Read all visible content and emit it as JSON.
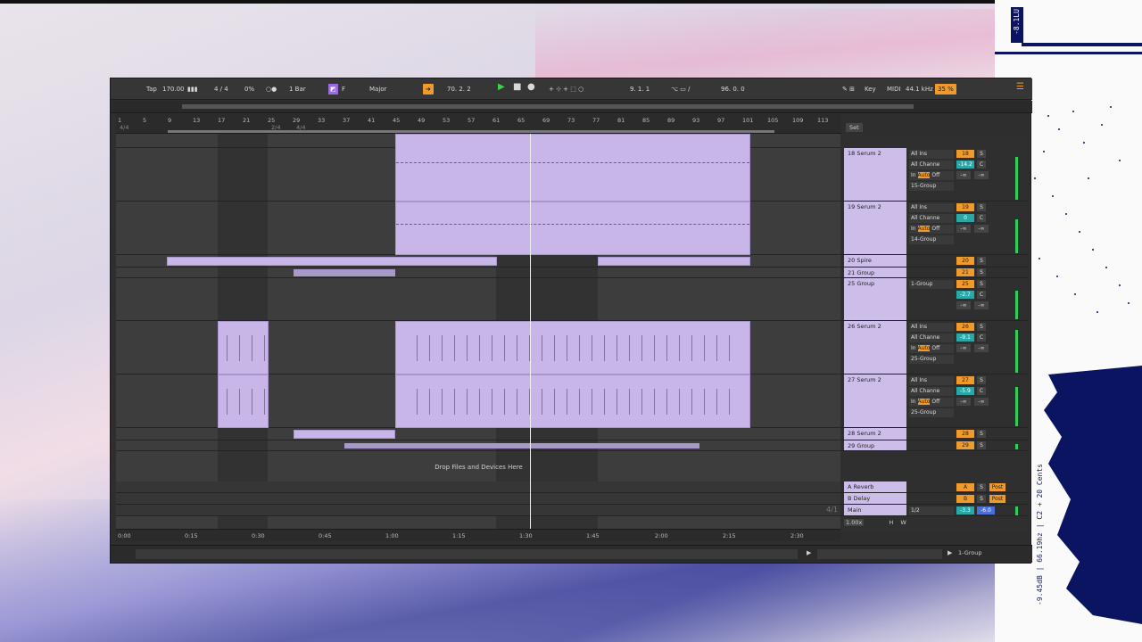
{
  "toolbar": {
    "tap": "Tap",
    "tempo": "170.00",
    "signature": "4 / 4",
    "swing": "0%",
    "quantize": "1 Bar",
    "key_root": "F",
    "scale": "Major",
    "position": "70.   2.   2",
    "loop_start": "9.   1.   1",
    "loop_length": "96.   0.   0",
    "key_label": "Key",
    "midi_label": "MIDI",
    "sample_rate": "44.1 kHz",
    "cpu": "35 %"
  },
  "ruler": {
    "bars": [
      "1",
      "5",
      "9",
      "13",
      "17",
      "21",
      "25",
      "29",
      "33",
      "37",
      "41",
      "45",
      "49",
      "53",
      "57",
      "61",
      "65",
      "69",
      "73",
      "77",
      "81",
      "85",
      "89",
      "93",
      "97",
      "101",
      "105",
      "109",
      "113"
    ],
    "sig_a": "4/4",
    "sig_b": "2/4",
    "sig_c": "4/4"
  },
  "timeline": {
    "times": [
      "0:00",
      "0:15",
      "0:30",
      "0:45",
      "1:00",
      "1:15",
      "1:30",
      "1:45",
      "2:00",
      "2:15",
      "2:30"
    ]
  },
  "arrangement": {
    "drop_hint": "Drop Files and Devices Here",
    "page_indicator": "4/1"
  },
  "mixer": {
    "set_label": "Set",
    "tracks": [
      {
        "name": "18 Serum 2",
        "input": "All Ins",
        "channel": "All Channe",
        "monitor_in": "In",
        "monitor_auto": "Auto",
        "monitor_off": "Off",
        "output": "15-Group",
        "number": "18",
        "volume": "-14.2",
        "pan": "C",
        "solo": "S",
        "send_a": "-∞",
        "send_b": "-∞"
      },
      {
        "name": "19 Serum 2",
        "input": "All Ins",
        "channel": "All Channe",
        "monitor_in": "In",
        "monitor_auto": "Auto",
        "monitor_off": "Off",
        "output": "14-Group",
        "number": "19",
        "volume": "0",
        "pan": "C",
        "solo": "S",
        "send_a": "-∞",
        "send_b": "-∞"
      },
      {
        "name": "20 Spire",
        "number": "20",
        "solo": "S"
      },
      {
        "name": "21 Group",
        "number": "21",
        "solo": "S"
      },
      {
        "name": "25 Group",
        "output": "1-Group",
        "number": "25",
        "volume": "-2.7",
        "pan": "C",
        "solo": "S",
        "send_a": "-∞",
        "send_b": "-∞"
      },
      {
        "name": "26 Serum 2",
        "input": "All Ins",
        "channel": "All Channe",
        "monitor_in": "In",
        "monitor_auto": "Auto",
        "monitor_off": "Off",
        "output": "25-Group",
        "number": "26",
        "volume": "-9.1",
        "pan": "C",
        "solo": "S",
        "send_a": "-∞",
        "send_b": "-∞"
      },
      {
        "name": "27 Serum 2",
        "input": "All Ins",
        "channel": "All Channe",
        "monitor_in": "In",
        "monitor_auto": "Auto",
        "monitor_off": "Off",
        "output": "25-Group",
        "number": "27",
        "volume": "-5.9",
        "pan": "C",
        "solo": "S",
        "send_a": "-∞",
        "send_b": "-∞"
      },
      {
        "name": "28 Serum 2",
        "number": "28",
        "solo": "S"
      },
      {
        "name": "29 Group",
        "number": "29",
        "solo": "S"
      }
    ],
    "returns": [
      {
        "name": "A Reverb",
        "letter": "A",
        "solo": "S",
        "post": "Post"
      },
      {
        "name": "B Delay",
        "letter": "B",
        "solo": "S",
        "post": "Post"
      },
      {
        "name": "Main",
        "output": "1/2",
        "volume": "-3.3",
        "volume2": "-6.0"
      }
    ],
    "zoom": "1.00x",
    "h": "H",
    "w": "W"
  },
  "statusbar": {
    "selected_track": "1-Group"
  },
  "analyzer": {
    "lufs": "-8.1LU",
    "readout": "-9.45dB | 66.19hz | C2 + 20 Cents"
  }
}
